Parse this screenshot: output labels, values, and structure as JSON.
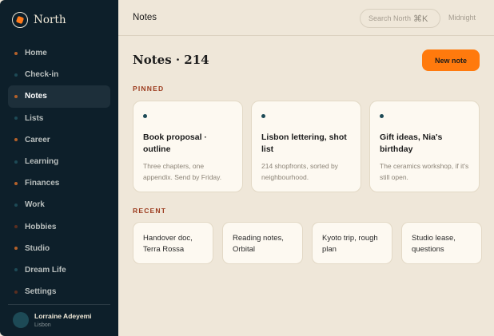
{
  "brand": {
    "name": "North"
  },
  "sidebar": {
    "items": [
      {
        "label": "Home",
        "color": "#b4612a",
        "active": false
      },
      {
        "label": "Check-in",
        "color": "#1d4a56",
        "active": false
      },
      {
        "label": "Notes",
        "color": "#b4612a",
        "active": true
      },
      {
        "label": "Lists",
        "color": "#1d4a56",
        "active": false
      },
      {
        "label": "Career",
        "color": "#b4612a",
        "active": false
      },
      {
        "label": "Learning",
        "color": "#1d4a56",
        "active": false
      },
      {
        "label": "Finances",
        "color": "#b4612a",
        "active": false
      },
      {
        "label": "Work",
        "color": "#1d4a56",
        "active": false
      },
      {
        "label": "Hobbies",
        "color": "#5a2e20",
        "active": false
      },
      {
        "label": "Studio",
        "color": "#b4612a",
        "active": false
      },
      {
        "label": "Dream Life",
        "color": "#1d4a56",
        "active": false
      },
      {
        "label": "Settings",
        "color": "#5a2e20",
        "active": false
      }
    ]
  },
  "user": {
    "name": "Lorraine Adeyemi",
    "location": "Lisbon"
  },
  "topbar": {
    "title": "Notes",
    "search_placeholder": "Search North",
    "search_shortcut": "⌘K",
    "theme": "Midnight"
  },
  "main": {
    "heading": "Notes · 214",
    "new_button": "New note",
    "pinned_label": "PINNED",
    "recent_label": "RECENT",
    "pinned": [
      {
        "title": "Book proposal · outline",
        "body": "Three chapters, one appendix. Send by Friday."
      },
      {
        "title": "Lisbon lettering, shot list",
        "body": "214 shopfronts, sorted by neighbourhood."
      },
      {
        "title": "Gift ideas, Nia's birthday",
        "body": "The ceramics workshop, if it's still open."
      }
    ],
    "recent": [
      {
        "title": "Handover doc, Terra Rossa"
      },
      {
        "title": "Reading notes, Orbital"
      },
      {
        "title": "Kyoto trip, rough plan"
      },
      {
        "title": "Studio lease, questions"
      }
    ]
  },
  "colors": {
    "accent": "#ff7a0d",
    "sidebar_bg": "#0d1f2a",
    "page_bg": "#efe7d9",
    "section_label": "#9b3a1d"
  }
}
